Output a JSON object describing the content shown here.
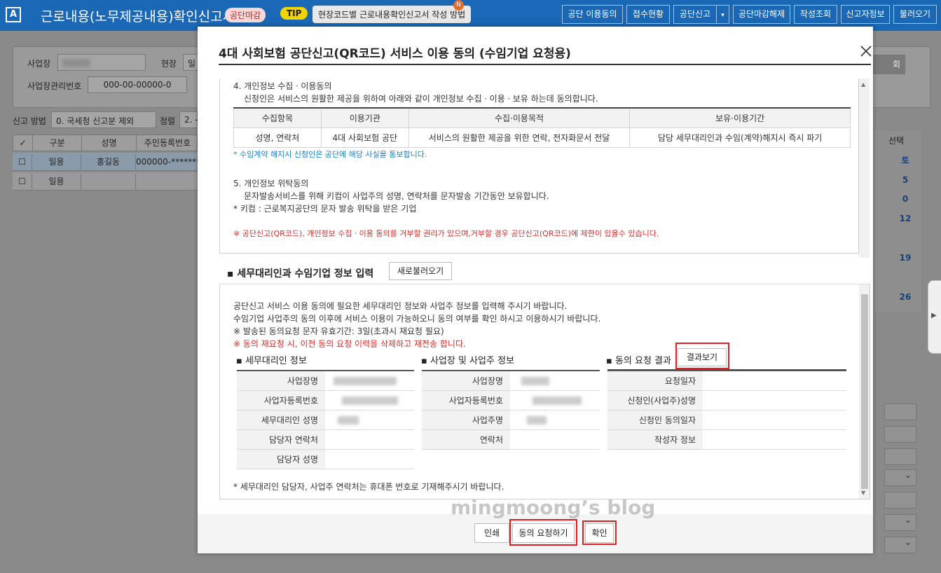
{
  "app": {
    "logo": "A",
    "title": "근로내용(노무제공내용)확인신고서",
    "deadline_badge": "공단마감",
    "tip_label": "TIP",
    "tip_text": "현장코드별 근로내용확인신고서 작성 방법",
    "tip_new": "N",
    "toolbar": [
      "공단 이용동의",
      "접수현황",
      "공단신고",
      "공단마감해제",
      "작성조회",
      "신고자정보",
      "불러오기"
    ]
  },
  "background": {
    "labels": {
      "business": "사업장",
      "site": "현장",
      "site_value": "일",
      "mgmt_no_label": "사업장관리번호",
      "mgmt_no": "000-00-00000-0",
      "report_method_label": "신고 방법",
      "report_method": "0. 국세청 신고분 제외",
      "sort_label": "정렬",
      "sort_value": "2. -",
      "query_btn": "회",
      "select_label": "선택"
    },
    "grid_headers": [
      "구분",
      "성명",
      "주민등록번호"
    ],
    "rows": [
      [
        "일용",
        "홍길동",
        "000000-*******"
      ],
      [
        "일용",
        "",
        ""
      ]
    ],
    "right_col": [
      "토",
      "5",
      "0",
      "12",
      "19",
      "26"
    ]
  },
  "modal": {
    "title": "4대 사회보험 공단신고(QR코드) 서비스 이용 동의 (수임기업 요청용)",
    "consent": {
      "sec4_title": "4. 개인정보 수집ㆍ이용동의",
      "sec4_desc": "신청인은 서비스의 원활한 제공을 위하여 아래와 같이 개인정보 수집ㆍ이용ㆍ보유 하는데 동의합니다.",
      "table_headers": [
        "수집항목",
        "이용기관",
        "수집·이용목적",
        "보유·이용기간"
      ],
      "table_row": [
        "성명, 연락처",
        "4대 사회보험 공단",
        "서비스의 원활한 제공을 위한 연락, 전자화문서 전달",
        "담당 세무대리인과 수임(계약)해지시 즉시 파기"
      ],
      "table_note": "* 수임계약 해지시 신청인은 공단에 해당 사실을 통보합니다.",
      "sec5_title": "5. 개인정보 위탁동의",
      "sec5_desc": "문자발송서비스를 위해 키컴이 사업주의 성명, 연락처를 문자발송 기간동안 보유합니다.",
      "sec5_note": "* 키컴 : 근로복지공단의 문자 발송 위탁을 받은 기업",
      "warning": "※ 공단신고(QR코드), 개인정보 수집ㆍ이용 동의를 거부할 권리가 있으며,거부할 경우 공단신고(QR코드)에 제한이 있을수 있습니다."
    },
    "info_section": {
      "title": "세무대리인과 수임기업 정보 입력",
      "reload_btn": "새로불러오기",
      "desc1": "공단신고 서비스 이용 동의에 필요한 세무대리인 정보와 사업주 정보를 입력해 주시기 바랍니다.",
      "desc2": "수임기업 사업주의 동의 이후에 서비스 이용이 가능하오니 동의 여부를 확인 하시고 이용하시기 바랍니다.",
      "desc3": "※ 발송된 동의요청 문자 유효기간: 3일(초과시 재요청 필요)",
      "desc4": "※ 동의 재요청 시, 이전 동의 요청 이력을 삭제하고 재전송 합니다.",
      "agent_title": "세무대리인 정보",
      "agent_fields": [
        "사업장명",
        "사업자등록번호",
        "세무대리인 성명",
        "담당자 연락처",
        "담당자 성명"
      ],
      "owner_title": "사업장 및 사업주 정보",
      "owner_fields": [
        "사업장명",
        "사업자등록번호",
        "사업주명",
        "연락처"
      ],
      "result_title": "동의 요청 결과",
      "result_btn": "결과보기",
      "result_fields": [
        "요청일자",
        "신청인(사업주)성명",
        "신청인 동의일자",
        "작성자 정보"
      ],
      "footnote": "* 세무대리인 담당자, 사업주 연락처는 휴대폰 번호로 기재해주시기 바랍니다."
    },
    "footer_buttons": {
      "print": "인쇄",
      "request": "동의 요청하기",
      "confirm": "확인"
    }
  },
  "watermark": "mingmoong’s blog",
  "colors": {
    "topbar": "#1a67b5",
    "highlight": "#e02020",
    "note_blue": "#1a7fc4",
    "warning_red": "#d62e2e"
  }
}
